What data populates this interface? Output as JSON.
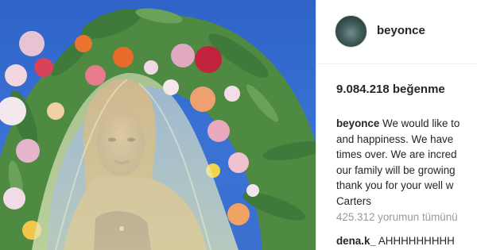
{
  "post": {
    "image_alt": "Woman in a sheer veil in front of a floral wreath on a blue background",
    "colors": {
      "sky": "#3a72d4",
      "roses": "#e8b7c8",
      "leaves": "#3f7a3a",
      "veil": "#dfe4b8"
    }
  },
  "header": {
    "username": "beyonce",
    "avatar_icon": "profile-avatar"
  },
  "stats": {
    "likes": "9.084.218 beğenme"
  },
  "caption": {
    "author": "beyonce",
    "lines": [
      "We would like to",
      "and happiness. We have",
      "times over. We are incred",
      "our family will be growing",
      "thank you for your well w",
      "Carters"
    ]
  },
  "comments": {
    "view_all": "425.312 yorumun tümünü",
    "items": [
      {
        "user": "dena.k_",
        "text": "AHHHHHHHHH"
      }
    ]
  }
}
